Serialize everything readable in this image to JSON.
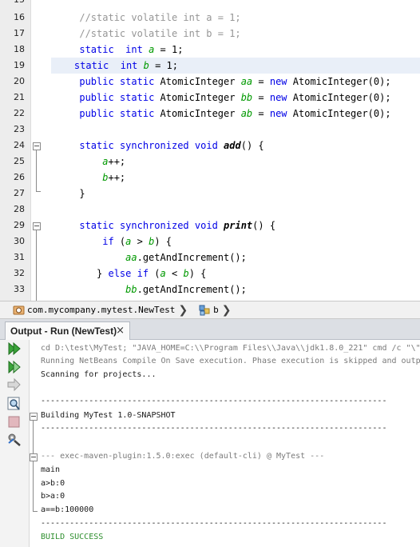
{
  "editor": {
    "gutter_lines": [
      "15",
      "16",
      "17",
      "18",
      "19",
      "20",
      "21",
      "22",
      "23",
      "24",
      "25",
      "26",
      "27",
      "28",
      "29",
      "30",
      "31",
      "32",
      "33"
    ],
    "code": {
      "l16": "//static volatile int a = 1;",
      "l17": "//static volatile int b = 1;",
      "kw_static": "static",
      "kw_int": "int",
      "kw_public": "public",
      "kw_new": "new",
      "kw_synchronized": "synchronized",
      "kw_void": "void",
      "kw_if": "if",
      "kw_else": "else",
      "type_atomic": "AtomicInteger",
      "var_a": "a",
      "var_b": "b",
      "var_aa": "aa",
      "var_bb": "bb",
      "var_ab": "ab",
      "eq_one": " = 1;",
      "ctor_zero": "AtomicInteger(0);",
      "m_add": "add",
      "m_print": "print",
      "inc": "++;",
      "get_and_inc": ".getAndIncrement();",
      "brace_close": "}",
      "else_open": "} else if (",
      "lt": " < ",
      "gt": " > "
    }
  },
  "breadcrumb": {
    "class_path": "com.mycompany.mytest.NewTest",
    "field": "b"
  },
  "output_panel": {
    "tab_title": "Output - Run (NewTest)",
    "close_glyph": "×",
    "lines": [
      "cd D:\\test\\MyTest; \"JAVA_HOME=C:\\\\Program Files\\\\Java\\\\jdk1.8.0_221\" cmd /c \"\\\"",
      "Running NetBeans Compile On Save execution. Phase execution is skipped and outp",
      "Scanning for projects...",
      "",
      "------------------------------------------------------------------------",
      "Building MyTest 1.0-SNAPSHOT",
      "------------------------------------------------------------------------",
      "",
      "--- exec-maven-plugin:1.5.0:exec (default-cli) @ MyTest ---",
      "main",
      "a>b:0",
      "b>a:0",
      "a==b:100000",
      "------------------------------------------------------------------------",
      "BUILD SUCCESS"
    ],
    "toolbar_icons": [
      "rerun-icon",
      "rerun-with-params-icon",
      "stop-arrow-icon",
      "find-icon",
      "clear-icon",
      "settings-icon"
    ]
  },
  "colors": {
    "keyword": "#0000e6",
    "comment": "#969696",
    "field": "#009900",
    "build_success": "#2f8f2f",
    "current_line": "#e9eff8"
  }
}
